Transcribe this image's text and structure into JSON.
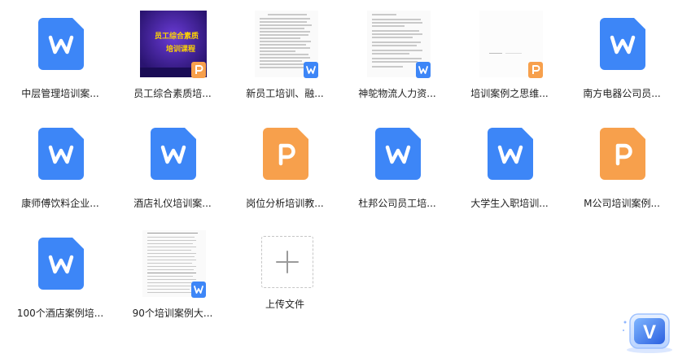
{
  "files": [
    {
      "name": "中层管理培训案...",
      "kind": "word",
      "thumb": "icon",
      "icon": "word-doc-icon"
    },
    {
      "name": "员工综合素质培...",
      "kind": "ppt",
      "thumb": "slide",
      "icon": "ppt-badge-icon",
      "preview_title_1": "员工综合素质",
      "preview_title_2": "培训课程"
    },
    {
      "name": "新员工培训、融...",
      "kind": "word",
      "thumb": "doc",
      "icon": "word-badge-icon"
    },
    {
      "name": "神鸵物流人力资...",
      "kind": "word",
      "thumb": "doc",
      "icon": "word-badge-icon"
    },
    {
      "name": "培训案例之思维...",
      "kind": "ppt",
      "thumb": "blank",
      "icon": "ppt-badge-icon"
    },
    {
      "name": "南方电器公司员...",
      "kind": "word",
      "thumb": "icon",
      "icon": "word-doc-icon"
    },
    {
      "name": "康师傅饮料企业...",
      "kind": "word",
      "thumb": "icon",
      "icon": "word-doc-icon"
    },
    {
      "name": "酒店礼仪培训案...",
      "kind": "word",
      "thumb": "icon",
      "icon": "word-doc-icon"
    },
    {
      "name": "岗位分析培训教...",
      "kind": "ppt",
      "thumb": "icon",
      "icon": "ppt-doc-icon"
    },
    {
      "name": "杜邦公司员工培...",
      "kind": "word",
      "thumb": "icon",
      "icon": "word-doc-icon"
    },
    {
      "name": "大学生入职培训...",
      "kind": "word",
      "thumb": "icon",
      "icon": "word-doc-icon"
    },
    {
      "name": "M公司培训案例...",
      "kind": "ppt",
      "thumb": "icon",
      "icon": "ppt-doc-icon"
    },
    {
      "name": "100个酒店案例培...",
      "kind": "word",
      "thumb": "icon",
      "icon": "word-doc-icon"
    },
    {
      "name": "90个培训案例大...",
      "kind": "word",
      "thumb": "toc",
      "icon": "word-badge-icon"
    }
  ],
  "upload": {
    "label": "上传文件",
    "icon": "plus-icon"
  },
  "floating_button": {
    "letter": "V",
    "icon": "v-logo-icon"
  },
  "colors": {
    "word": "#3d86f7",
    "ppt": "#f7a04c",
    "slide_bg": "#3a1f8f",
    "slide_text": "#ffd400"
  }
}
